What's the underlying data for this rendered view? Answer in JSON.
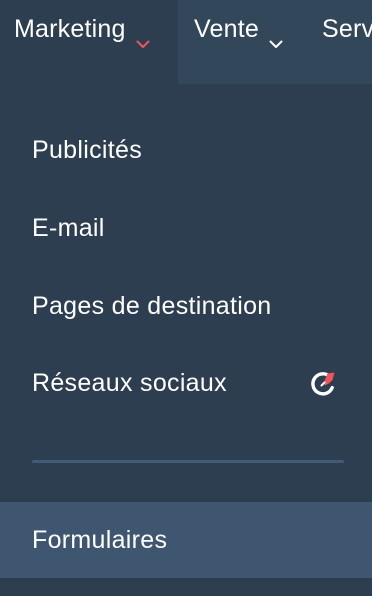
{
  "topnav": {
    "items": [
      {
        "label": "Marketing",
        "active": true,
        "chevron_color": "#f2545b"
      },
      {
        "label": "Vente",
        "active": false,
        "chevron_color": "#ffffff"
      },
      {
        "label": "Service",
        "active": false,
        "chevron_color": "#ffffff"
      }
    ]
  },
  "menu": {
    "items": [
      {
        "label": "Publicités"
      },
      {
        "label": "E-mail"
      },
      {
        "label": "Pages de destination"
      },
      {
        "label": "Réseaux sociaux",
        "icon": "upgrade-badge-icon"
      },
      {
        "label": "Formulaires",
        "highlighted": true
      }
    ]
  },
  "colors": {
    "background": "#2d3e50",
    "topnav": "#33475b",
    "hover": "#3e5670",
    "accent": "#f2545b"
  }
}
